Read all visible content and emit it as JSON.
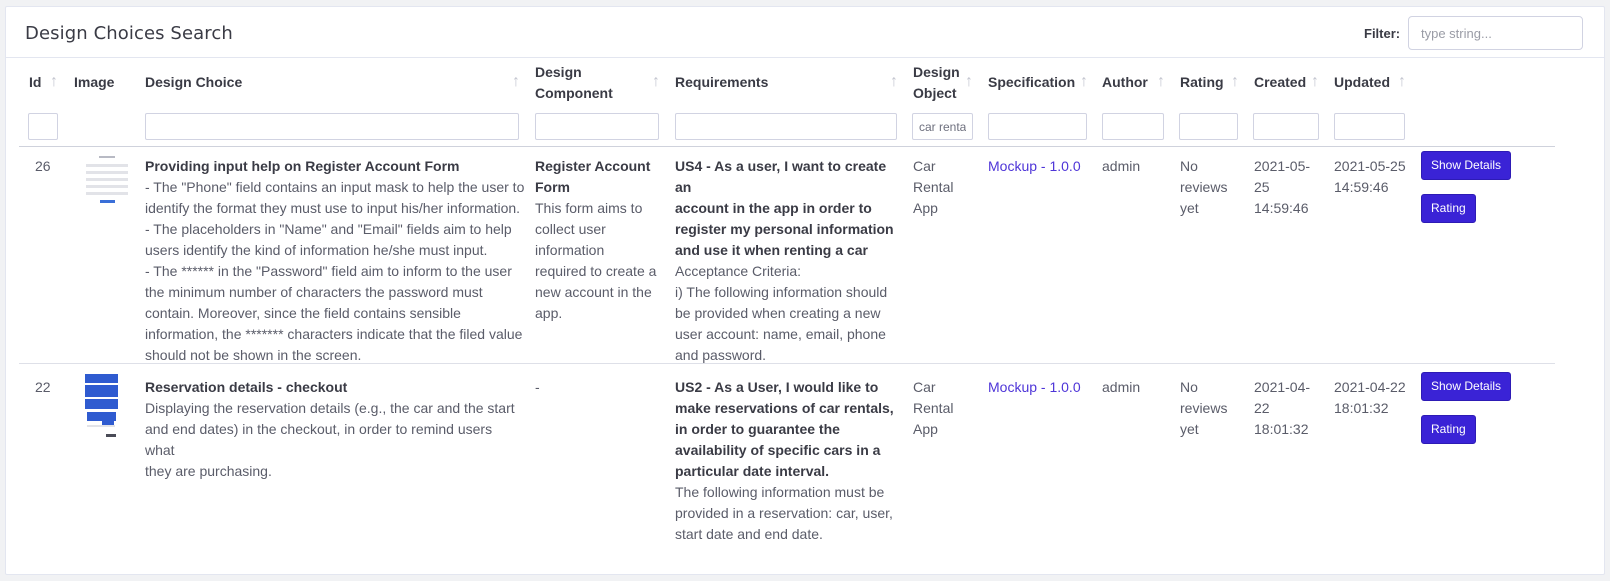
{
  "title": "Design Choices Search",
  "filter": {
    "label": "Filter:",
    "placeholder": "type string..."
  },
  "columns": {
    "id": "Id",
    "image": "Image",
    "design_choice": "Design Choice",
    "design_component_1": "Design",
    "design_component_2": "Component",
    "requirements": "Requirements",
    "design_object_1": "Design",
    "design_object_2": "Object",
    "specification": "Specification",
    "author": "Author",
    "rating": "Rating",
    "created": "Created",
    "updated": "Updated"
  },
  "column_filters": {
    "design_object_value": "car renta"
  },
  "rows": [
    {
      "id": "26",
      "choice_title": "Providing input help on Register Account Form",
      "choice_lines": [
        "- The \"Phone\" field contains an input mask to help the user to",
        "identify the format they must use to input his/her information.",
        "- The placeholders in \"Name\" and \"Email\" fields aim to help",
        "users identify the kind of information he/she must input.",
        "- The ****** in the \"Password\" field aim to inform to the user",
        "the minimum number of characters the password must",
        "contain. Moreover, since the field contains sensible",
        "information, the ******* characters indicate that the filed value",
        "should not be shown in the screen."
      ],
      "component_title_1": "Register Account",
      "component_title_2": "Form",
      "component_lines": [
        "This form aims to",
        "collect user",
        "information",
        "required to create a",
        "new account in the",
        "app."
      ],
      "req_bold_lines": [
        "US4 - As a user, I want to create an",
        "account in the app in order to",
        "register my personal information",
        "and use it when renting a car"
      ],
      "req_lines": [
        "Acceptance Criteria:",
        "i) The following information should",
        "be provided when creating a new",
        "user account: name, email, phone",
        "and password."
      ],
      "object_lines": [
        "Car",
        "Rental",
        "App"
      ],
      "specification": "Mockup - 1.0.0",
      "author": "admin",
      "rating_lines": [
        "No",
        "reviews",
        "yet"
      ],
      "created_lines": [
        "2021-05-",
        "25",
        "14:59:46"
      ],
      "updated_lines": [
        "2021-05-25",
        "14:59:46"
      ],
      "show_details": "Show Details",
      "rating_button": "Rating"
    },
    {
      "id": "22",
      "choice_title": "Reservation details - checkout",
      "choice_lines": [
        "Displaying the reservation details (e.g., the car and the start",
        "and end dates) in the checkout, in order to remind users what",
        "they are purchasing."
      ],
      "component_dash": "-",
      "req_bold_lines": [
        "US2 - As a User, I would like to",
        "make reservations of car rentals,",
        "in order to guarantee the",
        "availability of specific cars in a",
        "particular date interval."
      ],
      "req_lines": [
        "The following information must be",
        "provided in a reservation: car, user,",
        "start date and end date."
      ],
      "object_lines": [
        "Car",
        "Rental",
        "App"
      ],
      "specification": "Mockup - 1.0.0",
      "author": "admin",
      "rating_lines": [
        "No",
        "reviews",
        "yet"
      ],
      "created_lines": [
        "2021-04-",
        "22",
        "18:01:32"
      ],
      "updated_lines": [
        "2021-04-22",
        "18:01:32"
      ],
      "show_details": "Show Details",
      "rating_button": "Rating"
    }
  ]
}
